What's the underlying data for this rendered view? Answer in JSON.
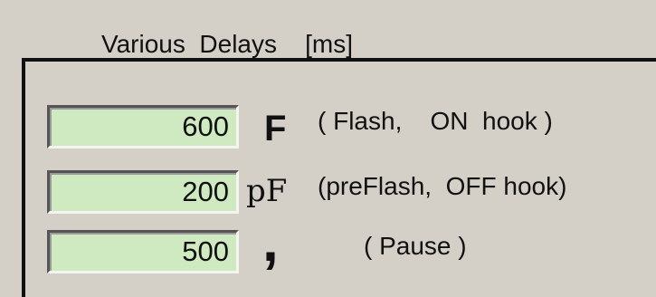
{
  "group": {
    "title": "Various  Delays    [ms]"
  },
  "rows": [
    {
      "value": "600",
      "code": "F",
      "desc": "( Flash,    ON  hook )"
    },
    {
      "value": "200",
      "code": "pF",
      "desc": "(preFlash,  OFF hook)"
    },
    {
      "value": "500",
      "code": ",",
      "desc": "( Pause )"
    }
  ],
  "colors": {
    "field_background": "#cfeac0",
    "window_background": "#d4d0c8"
  }
}
